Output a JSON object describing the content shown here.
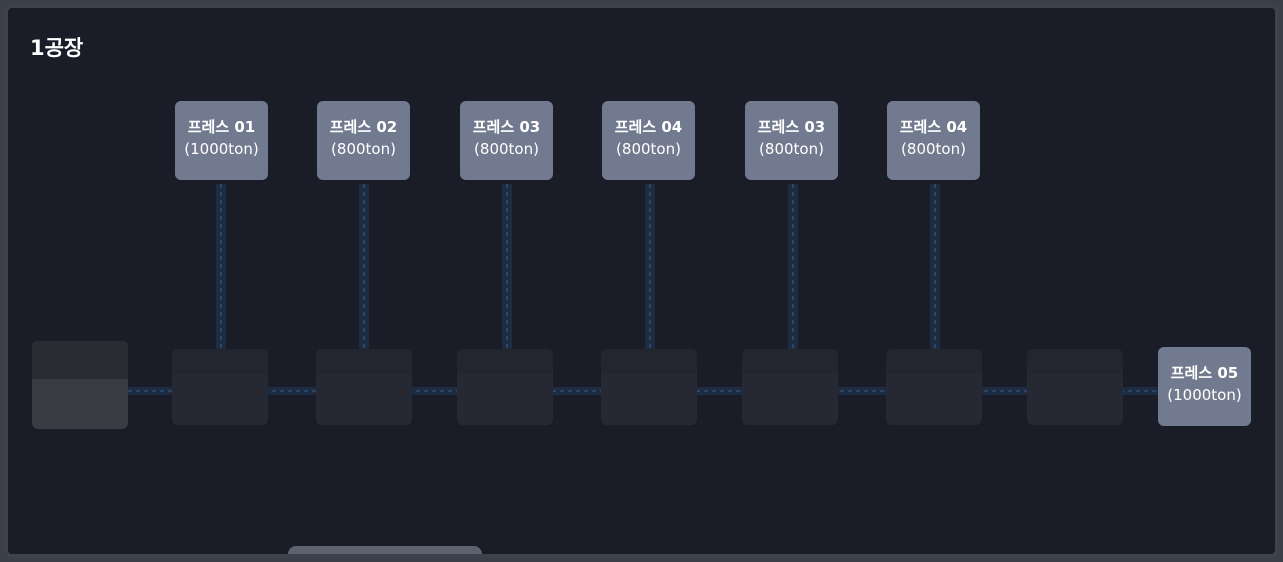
{
  "title": "1공장",
  "presses": [
    {
      "name": "프레스 01",
      "capacity": "(1000ton)"
    },
    {
      "name": "프레스 02",
      "capacity": "(800ton)"
    },
    {
      "name": "프레스 03",
      "capacity": "(800ton)"
    },
    {
      "name": "프레스 04",
      "capacity": "(800ton)"
    },
    {
      "name": "프레스 03",
      "capacity": "(800ton)"
    },
    {
      "name": "프레스 04",
      "capacity": "(800ton)"
    }
  ],
  "end_press": {
    "name": "프레스 05",
    "capacity": "(1000ton)"
  },
  "colors": {
    "background": "#1a1d27",
    "frame_border": "#3e424d",
    "press_node": "#717a8e",
    "slot": "#262933",
    "connector": "#1c2c42"
  }
}
